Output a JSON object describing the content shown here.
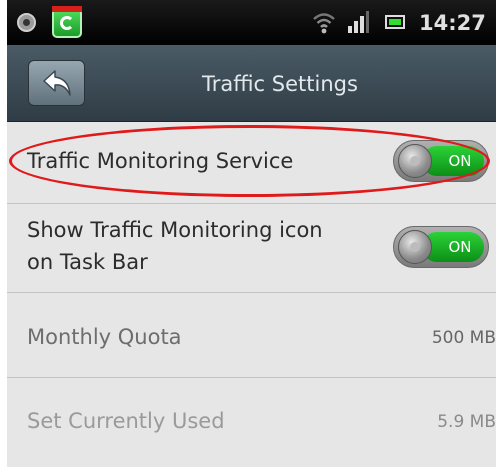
{
  "status_bar": {
    "time": "14:27",
    "icons": [
      "settings-icon",
      "comodo-app-icon",
      "wifi-icon",
      "signal-icon",
      "battery-icon"
    ]
  },
  "header": {
    "title": "Traffic Settings",
    "back_icon": "back-arrow-icon"
  },
  "settings": [
    {
      "label": "Traffic Monitoring Service",
      "toggle_text": "ON",
      "state": "on"
    },
    {
      "label_line1": "Show Traffic Monitoring icon",
      "label_line2": "on Task Bar",
      "toggle_text": "ON",
      "state": "on"
    },
    {
      "label": "Monthly Quota",
      "value": "500 MB"
    },
    {
      "label": "Set Currently Used",
      "value": "5.9 MB"
    }
  ],
  "colors": {
    "toggle_on": "#1fb82b",
    "highlight": "#e0191b",
    "titlebar": "#3d4b55"
  }
}
